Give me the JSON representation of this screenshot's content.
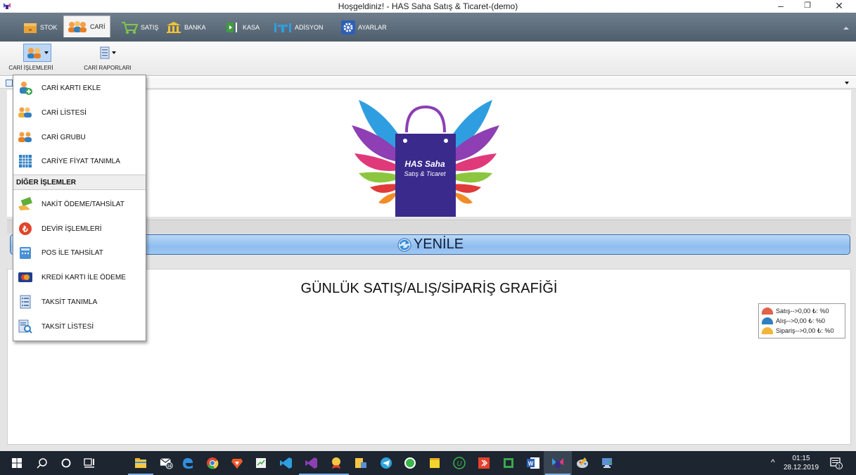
{
  "window": {
    "title": "Hoşgeldiniz! - HAS Saha Satış & Ticaret-(demo)",
    "minimize_glyph": "–",
    "restore_glyph": "❐",
    "close_glyph": "✕"
  },
  "tabs": [
    {
      "label": "STOK",
      "icon": "box-icon",
      "active": false
    },
    {
      "label": "CARİ",
      "icon": "users-icon",
      "active": true
    },
    {
      "label": "SATIŞ",
      "icon": "cart-icon",
      "active": false
    },
    {
      "label": "BANKA",
      "icon": "bank-icon",
      "active": false
    },
    {
      "label": "KASA",
      "icon": "cash-register-icon",
      "active": false
    },
    {
      "label": "ADİSYON",
      "icon": "table-chairs-icon",
      "active": false
    },
    {
      "label": "AYARLAR",
      "icon": "gear-icon",
      "active": false
    }
  ],
  "ribbon": {
    "cari_islemleri": "CARİ İŞLEMLERİ",
    "cari_raporlari": "CARİ RAPORLARI"
  },
  "menu": {
    "items_top": [
      {
        "label": "CARİ KARTI EKLE",
        "icon": "user-add-icon"
      },
      {
        "label": "CARİ LİSTESİ",
        "icon": "users-list-icon"
      },
      {
        "label": "CARİ GRUBU",
        "icon": "user-group-icon"
      },
      {
        "label": "CARİYE FİYAT TANIMLA",
        "icon": "price-grid-icon"
      }
    ],
    "section_label": "DİĞER İŞLEMLER",
    "items_bottom": [
      {
        "label": "NAKİT ÖDEME/TAHSİLAT",
        "icon": "cash-payment-icon"
      },
      {
        "label": "DEVİR İŞLEMLERİ",
        "icon": "lira-icon"
      },
      {
        "label": "POS İLE TAHSİLAT",
        "icon": "pos-terminal-icon"
      },
      {
        "label": "KREDİ KARTI İLE ÖDEME",
        "icon": "credit-card-icon"
      },
      {
        "label": "TAKSİT TANIMLA",
        "icon": "document-list-icon"
      },
      {
        "label": "TAKSİT LİSTESİ",
        "icon": "document-search-icon"
      }
    ]
  },
  "logo": {
    "line1": "HAS Saha",
    "line2": "Satış & Ticaret"
  },
  "refresh_label": "YENİLE",
  "chart": {
    "title": "GÜNLÜK SATIŞ/ALIŞ/SİPARİŞ GRAFİĞİ",
    "legend": [
      {
        "label": "Satış-->0,00 ₺: %0",
        "color": "#e0634a"
      },
      {
        "label": "Alış-->0,00 ₺: %0",
        "color": "#2f7fc1"
      },
      {
        "label": "Sipariş-->0,00 ₺: %0",
        "color": "#f2b53a"
      }
    ]
  },
  "taskbar": {
    "time": "01:15",
    "date": "28.12.2019",
    "badge_mail": "14",
    "badge_notif": "1"
  }
}
